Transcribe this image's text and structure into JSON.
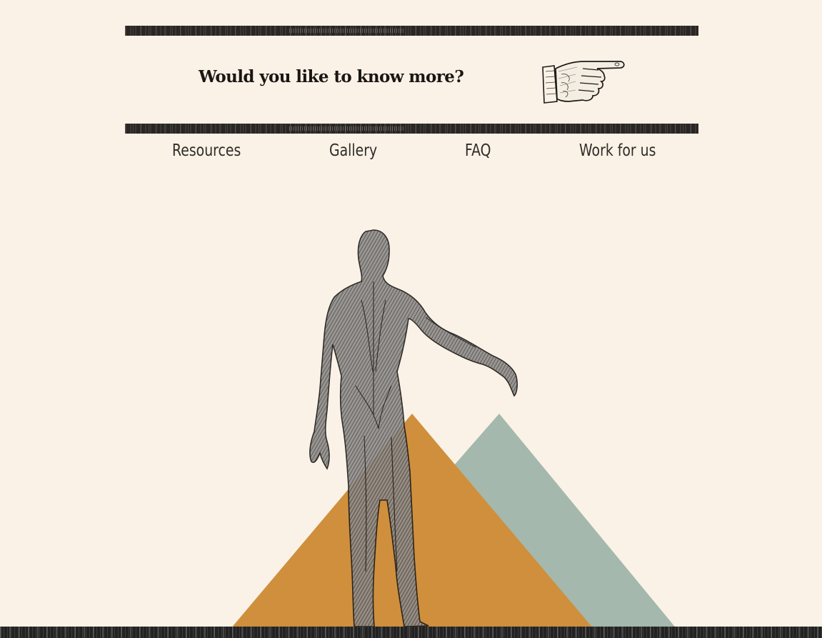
{
  "header": {
    "cta_text": "Would you like to know more?",
    "hand_icon": "pointing-hand-icon"
  },
  "nav": {
    "items": [
      {
        "label": "Resources"
      },
      {
        "label": "Gallery"
      },
      {
        "label": "FAQ"
      },
      {
        "label": "Work for us"
      }
    ]
  },
  "colors": {
    "background": "#faf2e6",
    "rule": "#2a2624",
    "text": "#2f2b28",
    "triangle_ochre": "#cf8f3c",
    "triangle_sage": "#a4b8ad"
  },
  "hero": {
    "figure": "anatomical-figure-illustration"
  }
}
